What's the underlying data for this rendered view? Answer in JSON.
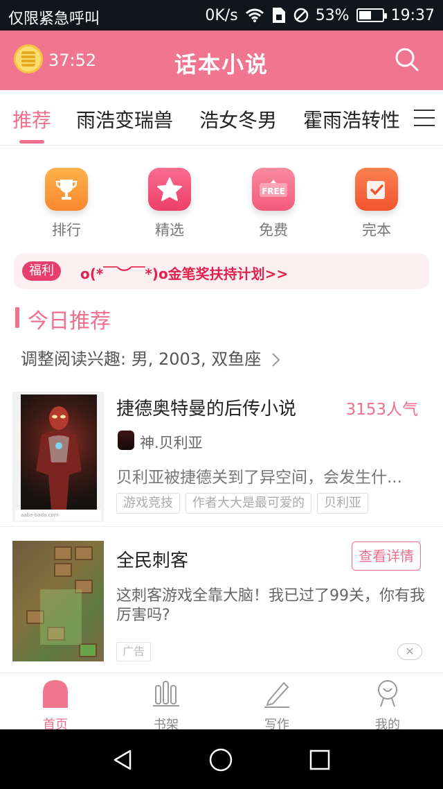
{
  "status_bar": {
    "carrier": "仅限紧急呼叫",
    "net_speed": "0K/s",
    "battery": "53%",
    "battery_level": 0.53,
    "time": "19:37"
  },
  "header": {
    "timer": "37:52",
    "title": "话本小说"
  },
  "tabs": [
    {
      "label": "推荐",
      "active": true
    },
    {
      "label": "雨浩变瑞兽",
      "active": false
    },
    {
      "label": "浩女冬男",
      "active": false
    },
    {
      "label": "霍雨浩转性",
      "active": false
    }
  ],
  "categories": [
    {
      "label": "排行",
      "icon": "trophy-icon",
      "color": "#fb9a3b"
    },
    {
      "label": "精选",
      "icon": "star-icon",
      "color": "#f2557a"
    },
    {
      "label": "免费",
      "icon": "free-tag-icon",
      "color": "#f46a86"
    },
    {
      "label": "完本",
      "icon": "check-icon",
      "color": "#f6673e"
    }
  ],
  "banner": {
    "badge": "福利",
    "text": "o(*￣︶￣*)o金笔奖扶持计划>>"
  },
  "section": {
    "title": "今日推荐",
    "interest": "调整阅读兴趣: 男, 2003, 双鱼座"
  },
  "book": {
    "title": "捷德奥特曼的后传小说",
    "popularity": "3153人气",
    "author": "神.贝利亚",
    "description": "贝利亚被捷德关到了异空间，会发生什...",
    "tags": [
      "游戏竞技",
      "作者大大是最可爱的",
      "贝利亚"
    ],
    "cover_caption": "aaba-bada.com"
  },
  "ad": {
    "title": "全民刺客",
    "button": "查看详情",
    "description": "这刺客游戏全靠大脑！我已过了99关，你有我厉害吗?",
    "tag": "广告",
    "close": "✕"
  },
  "bottom_nav": [
    {
      "label": "首页",
      "icon": "home-icon",
      "active": true
    },
    {
      "label": "书架",
      "icon": "bookshelf-icon",
      "active": false
    },
    {
      "label": "写作",
      "icon": "pen-icon",
      "active": false
    },
    {
      "label": "我的",
      "icon": "profile-icon",
      "active": false
    }
  ],
  "colors": {
    "primary": "#f07590",
    "accent_text": "#ef6f8c",
    "banner_text": "#e3214c"
  }
}
